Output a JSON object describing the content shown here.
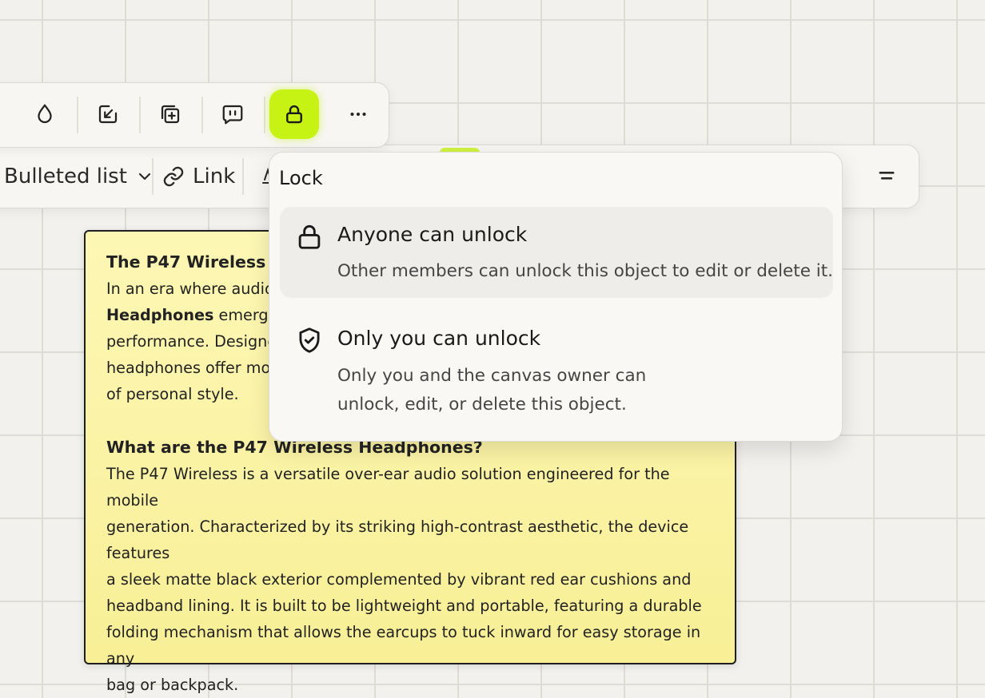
{
  "toolbar": {
    "buttons": [
      {
        "name": "color",
        "icon": "droplet-icon"
      },
      {
        "name": "export",
        "icon": "external-link-icon"
      },
      {
        "name": "duplicate",
        "icon": "duplicate-icon"
      },
      {
        "name": "comment",
        "icon": "comment-icon"
      },
      {
        "name": "lock",
        "icon": "lock-icon",
        "active": true,
        "accent": "#c6f313"
      },
      {
        "name": "more",
        "icon": "more-icon"
      }
    ]
  },
  "format_bar": {
    "list_label": "Bulleted list",
    "link_label": "Link"
  },
  "lock_menu": {
    "title": "Lock",
    "options": [
      {
        "title": "Anyone can unlock",
        "description": "Other members can unlock this object to edit or delete it.",
        "icon": "lock-icon",
        "selected": true
      },
      {
        "title": "Only you can unlock",
        "description_lines": [
          "Only you and the canvas owner can",
          "unlock, edit, or delete this object."
        ],
        "icon": "shield-check-icon",
        "selected": false
      }
    ]
  },
  "note": {
    "heading1": "The P47 Wireless E",
    "para1_lines": [
      "In an era where audio",
      "emerge",
      "performance. Designe",
      "headphones offer mor",
      "of personal style."
    ],
    "para1_bold": "Headphones",
    "heading2": "What are the P47 Wireless Headphones?",
    "para2_lines": [
      "The P47 Wireless is a versatile over-ear audio solution engineered for the mobile",
      "generation. Characterized by its striking high-contrast aesthetic, the device features",
      "a sleek matte black exterior complemented by vibrant red ear cushions and",
      "headband lining. It is built to be lightweight and portable, featuring a durable",
      "folding mechanism that allows the earcups to tuck inward for easy storage in any",
      "bag or backpack."
    ]
  }
}
